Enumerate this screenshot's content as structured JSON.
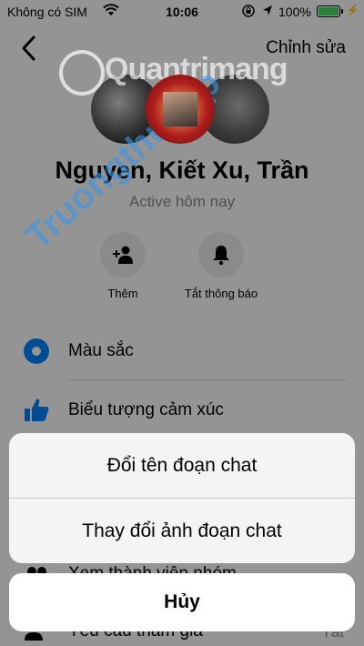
{
  "status_bar": {
    "carrier": "Không có SIM",
    "time": "10:06",
    "battery_percent": "100%",
    "battery_level": 1.0,
    "battery_color": "#4cd964"
  },
  "nav": {
    "back_icon": "chevron-left-icon",
    "edit_label": "Chỉnh sửa"
  },
  "conversation": {
    "name": "Nguyen, Kiết Xu, Trần",
    "status": "Active hôm nay"
  },
  "actions": [
    {
      "icon": "add-person-icon",
      "label": "Thêm"
    },
    {
      "icon": "bell-icon",
      "label": "Tắt thông báo"
    }
  ],
  "settings": [
    {
      "icon": "color-dot-icon",
      "label": "Màu sắc",
      "color": "#0084ff"
    },
    {
      "icon": "thumbs-up-icon",
      "label": "Biểu tượng cảm xúc",
      "color": "#0084ff"
    },
    {
      "icon": "people-icon",
      "label": "Xem thành viên nhóm",
      "value": ""
    },
    {
      "icon": "request-icon",
      "label": "Yêu cầu tham gia",
      "value": "Tắt"
    }
  ],
  "action_sheet": {
    "options": [
      "Đổi tên đoạn chat",
      "Thay đổi ảnh đoạn chat"
    ],
    "cancel": "Hủy"
  },
  "watermarks": [
    "Quantrimang",
    "Truongthu.top"
  ]
}
